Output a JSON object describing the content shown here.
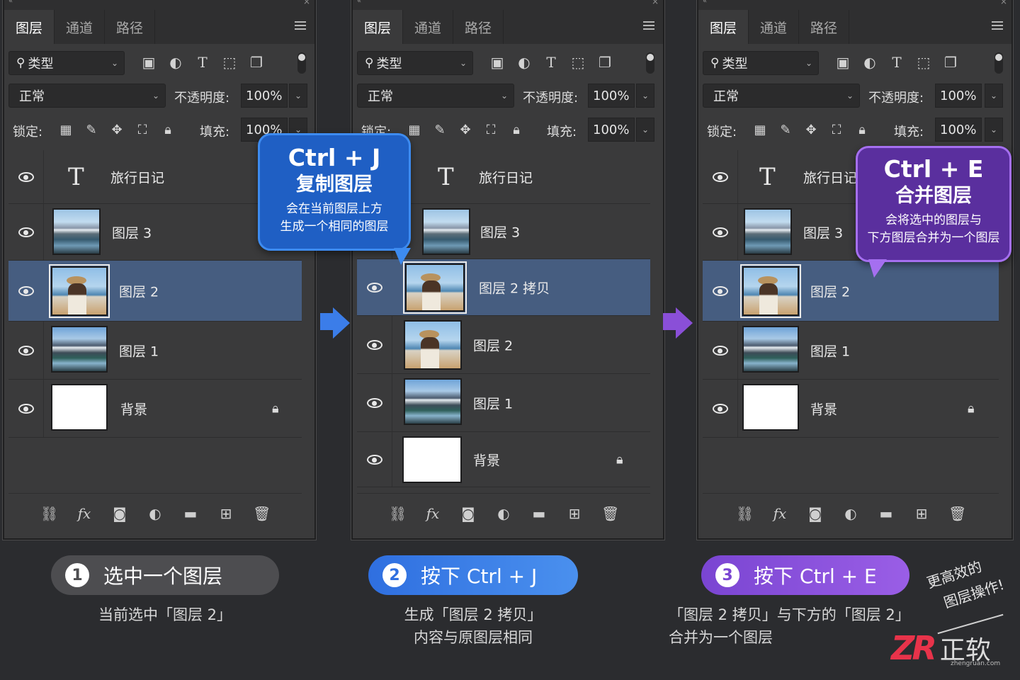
{
  "colors": {
    "bg": "#2b2c2f",
    "panel": "#3a3a3b",
    "selected": "#465d80",
    "blue": "#3b7de9",
    "purple": "#8a4fd8",
    "gray_pill": "#4d4d50",
    "logo_red": "#e8334a"
  },
  "panels": [
    {
      "tabs": [
        "图层",
        "通道",
        "路径"
      ],
      "filter_label": "类型",
      "blend_mode": "正常",
      "opacity_label": "不透明度:",
      "opacity_value": "100%",
      "lock_label": "锁定:",
      "fill_label": "填充:",
      "fill_value": "100%",
      "layers": [
        {
          "name": "旅行日记",
          "kind": "text"
        },
        {
          "name": "图层 3",
          "kind": "lake"
        },
        {
          "name": "图层 2",
          "kind": "woman",
          "selected": true
        },
        {
          "name": "图层 1",
          "kind": "mountain"
        },
        {
          "name": "背景",
          "kind": "white",
          "locked": true
        }
      ]
    },
    {
      "tabs": [
        "图层",
        "通道",
        "路径"
      ],
      "filter_label": "类型",
      "blend_mode": "正常",
      "opacity_label": "不透明度:",
      "opacity_value": "100%",
      "lock_label": "锁定:",
      "fill_label": "填充:",
      "fill_value": "100%",
      "layers": [
        {
          "name": "旅行日记",
          "kind": "text"
        },
        {
          "name": "图层 3",
          "kind": "lake"
        },
        {
          "name": "图层 2 拷贝",
          "kind": "woman",
          "selected": true
        },
        {
          "name": "图层 2",
          "kind": "woman"
        },
        {
          "name": "图层 1",
          "kind": "mountain"
        },
        {
          "name": "背景",
          "kind": "white",
          "locked": true
        }
      ]
    },
    {
      "tabs": [
        "图层",
        "通道",
        "路径"
      ],
      "filter_label": "类型",
      "blend_mode": "正常",
      "opacity_label": "不透明度:",
      "opacity_value": "100%",
      "lock_label": "锁定:",
      "fill_label": "填充:",
      "fill_value": "100%",
      "layers": [
        {
          "name": "旅行日记",
          "kind": "text"
        },
        {
          "name": "图层 3",
          "kind": "lake"
        },
        {
          "name": "图层 2",
          "kind": "woman",
          "selected": true
        },
        {
          "name": "图层 1",
          "kind": "mountain"
        },
        {
          "name": "背景",
          "kind": "white",
          "locked": true
        }
      ]
    }
  ],
  "bottom_icons": [
    "link-icon",
    "fx-icon",
    "mask-icon",
    "adjustment-icon",
    "folder-icon",
    "new-layer-icon",
    "trash-icon"
  ],
  "bubble1": {
    "keys": "Ctrl + J",
    "title": "复制图层",
    "desc1": "会在当前图层上方",
    "desc2": "生成一个相同的图层"
  },
  "bubble2": {
    "keys": "Ctrl + E",
    "title": "合并图层",
    "desc1": "会将选中的图层与",
    "desc2": "下方图层合并为一个图层"
  },
  "steps": [
    {
      "num": "1",
      "label": "选中一个图层",
      "caption1": "当前选中「图层 2」",
      "caption2": ""
    },
    {
      "num": "2",
      "label": "按下 Ctrl + J",
      "caption1": "生成「图层 2 拷贝」",
      "caption2": "内容与原图层相同"
    },
    {
      "num": "3",
      "label": "按下 Ctrl + E",
      "caption1": "「图层 2 拷贝」与下方的「图层 2」",
      "caption2": "合并为一个图层"
    }
  ],
  "slogan": {
    "line1": "更高效的",
    "line2": "图层操作!"
  },
  "logo": {
    "mark": "ZR",
    "name": "正软",
    "domain": "zhengruan.com"
  }
}
